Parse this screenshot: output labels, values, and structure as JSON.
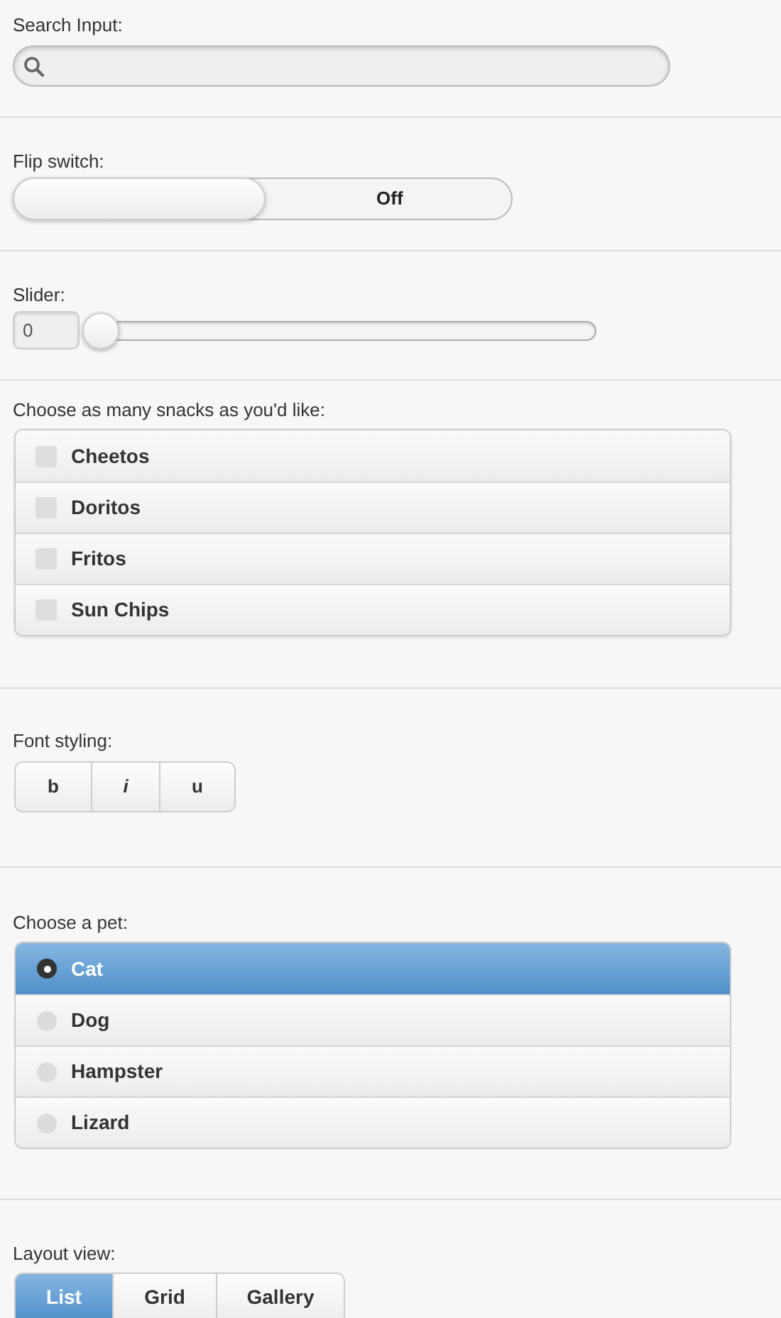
{
  "search": {
    "label": "Search Input:"
  },
  "flip_switch": {
    "label": "Flip switch:",
    "off_text": "Off",
    "on": false
  },
  "slider": {
    "label": "Slider:",
    "value": "0",
    "level": 0
  },
  "snacks": {
    "label": "Choose as many snacks as you'd like:",
    "options": [
      {
        "label": "Cheetos",
        "checked": false
      },
      {
        "label": "Doritos",
        "checked": false
      },
      {
        "label": "Fritos",
        "checked": false
      },
      {
        "label": "Sun Chips",
        "checked": false
      }
    ]
  },
  "font_styling": {
    "label": "Font styling:",
    "buttons": [
      {
        "label": "b",
        "kind": "bold",
        "selected": false
      },
      {
        "label": "i",
        "kind": "italic",
        "selected": false
      },
      {
        "label": "u",
        "kind": "underline",
        "selected": false
      }
    ]
  },
  "pet": {
    "label": "Choose a pet:",
    "options": [
      {
        "label": "Cat",
        "selected": true
      },
      {
        "label": "Dog",
        "selected": false
      },
      {
        "label": "Hampster",
        "selected": false
      },
      {
        "label": "Lizard",
        "selected": false
      }
    ]
  },
  "layout_view": {
    "label": "Layout view:",
    "options": [
      {
        "label": "List",
        "selected": true
      },
      {
        "label": "Grid",
        "selected": false
      },
      {
        "label": "Gallery",
        "selected": false
      }
    ]
  }
}
